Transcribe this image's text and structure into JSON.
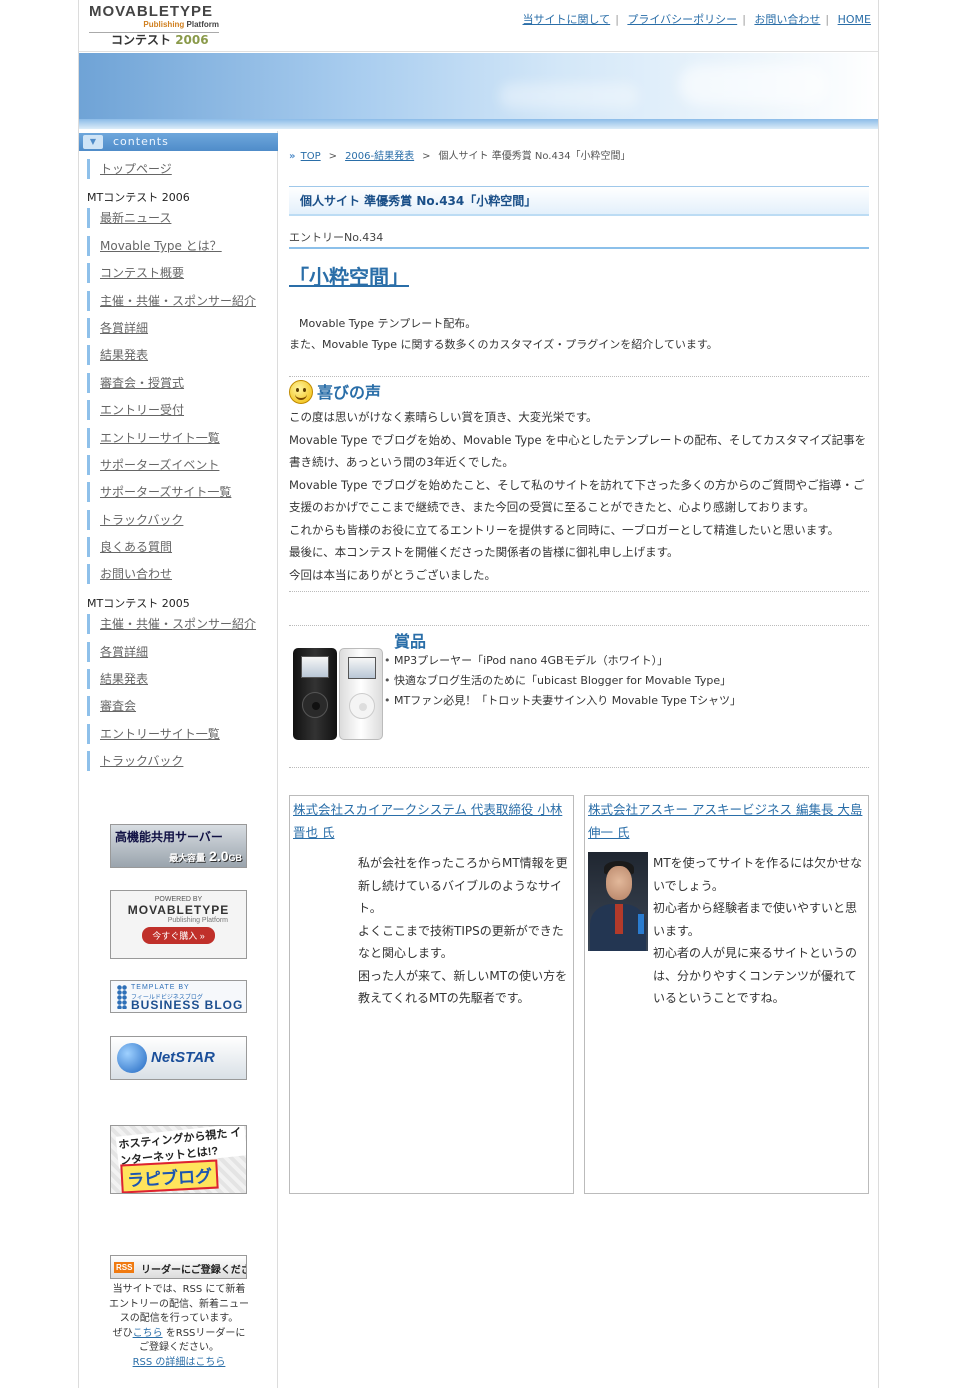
{
  "header": {
    "logo": {
      "brand": "MOVABLETYPE",
      "sub_publishing": "Publishing",
      "sub_platform": "Platform",
      "contest": "コンテスト",
      "year": "2006"
    },
    "nav": [
      {
        "label": "当サイトに関して"
      },
      {
        "label": "プライバシーポリシー"
      },
      {
        "label": "お問い合わせ"
      },
      {
        "label": "HOME"
      }
    ],
    "separator": "|"
  },
  "sidebar": {
    "heading": "contents",
    "top_item": "トップページ",
    "section_2006": "MTコンテスト 2006",
    "items_2006": [
      "最新ニュース",
      "Movable Type とは？",
      "コンテスト概要",
      "主催・共催・スポンサー紹介",
      "各賞詳細",
      "結果発表",
      "審査会・授賞式",
      "エントリー受付",
      "エントリーサイト一覧",
      "サポーターズイベント",
      "サポーターズサイト一覧",
      "トラックバック",
      "良くある質問",
      "お問い合わせ"
    ],
    "section_2005": "MTコンテスト 2005",
    "items_2005": [
      "主催・共催・スポンサー紹介",
      "各賞詳細",
      "結果発表",
      "審査会",
      "エントリーサイト一覧",
      "トラックバック"
    ],
    "banners": {
      "server": {
        "line1": "高機能共用サーバー",
        "cap_label": "最大容量",
        "cap_value": "2.0",
        "cap_unit": "GB"
      },
      "mt": {
        "powered": "POWERED BY",
        "brand": "MOVABLETYPE",
        "platform": "Publishing Platform",
        "buy": "今すぐ購入 »"
      },
      "bizblog": {
        "line1": "TEMPLATE BY",
        "line2": "フィールドビジネスブログ",
        "line3": "BUSINESS BLOG"
      },
      "netstar": {
        "name": "NetSTAR"
      },
      "rapi": {
        "line1": "ホスティングから視た インターネットとは!?",
        "line2": "ラピブログ"
      },
      "rss": {
        "badge": "RSS",
        "label": "リーダーにご登録ください"
      }
    },
    "rss_note": {
      "line1": "当サイトでは、RSS にて新着",
      "line2": "エントリーの配信、新着ニュー",
      "line3": "スの配信を行っています。",
      "line4_pre": "ぜひ",
      "line4_link": "こちら",
      "line4_post": "をRSSリーダーに",
      "line5": "ご登録ください。",
      "details_link": "RSS の詳細はこちら"
    }
  },
  "main": {
    "breadcrumb": {
      "icon": "»",
      "top": "TOP",
      "sep": ">",
      "results": "2006-結果発表",
      "current": "個人サイト 準優秀賞 No.434「小粋空間」"
    },
    "title_bar": "個人サイト 準優秀賞 No.434「小粋空間」",
    "entry_no": "エントリーNo.434",
    "entry_title": "「小粋空間」",
    "description": [
      "Movable Type テンプレート配布。",
      "また、Movable Type に関する数多くのカスタマイズ・プラグインを紹介しています。"
    ],
    "voice": {
      "heading": "喜びの声",
      "lines": [
        "この度は思いがけなく素晴らしい賞を頂き、大変光栄です。",
        "Movable Type でブログを始め、Movable Type を中心としたテンプレートの配布、そしてカスタマイズ記事を書き続け、あっという間の3年近くでした。",
        "Movable Type でブログを始めたこと、そして私のサイトを訪れて下さった多くの方からのご質問やご指導・ご支援のおかげでここまで継続でき、また今回の受賞に至ることができたと、心より感謝しております。",
        "これからも皆様のお役に立てるエントリーを提供すると同時に、一ブロガーとして精進したいと思います。",
        "最後に、本コンテストを開催くださった関係者の皆様に御礼申し上げます。",
        "今回は本当にありがとうございました。"
      ]
    },
    "prize": {
      "heading": "賞品",
      "items": [
        "MP3プレーヤー「iPod nano 4GBモデル（ホワイト）」",
        "快適なブログ生活のために「ubicast Blogger for Movable Type」",
        "MTファン必見！「トロット夫妻サイン入り Movable Type Tシャツ」"
      ]
    },
    "reviews": [
      {
        "who": "株式会社スカイアークシステム 代表取締役 小林 晋也 氏",
        "lines": [
          "私が会社を作ったころからMT情報を更新し続けているバイブルのようなサイト。",
          "よくここまで技術TIPSの更新ができたなと関心します。",
          "困った人が来て、新しいMTの使い方を教えてくれるMTの先駆者です。"
        ]
      },
      {
        "who": "株式会社アスキー アスキービジネス 編集長 大島 伸一 氏",
        "lines": [
          "MTを使ってサイトを作るには欠かせないでしょう。",
          "初心者から経験者まで使いやすいと思います。",
          "初心者の人が見に来るサイトというのは、分かりやすくコンテンツが優れているということですね。"
        ]
      }
    ]
  },
  "colors": {
    "link": "#2a6ea8",
    "accent_blue": "#4f8cc9",
    "nav_bar": "#8ec0ea"
  },
  "icons": [
    "contents-toggle-icon",
    "breadcrumb-arrow-icon",
    "smile-icon",
    "rss-icon"
  ]
}
